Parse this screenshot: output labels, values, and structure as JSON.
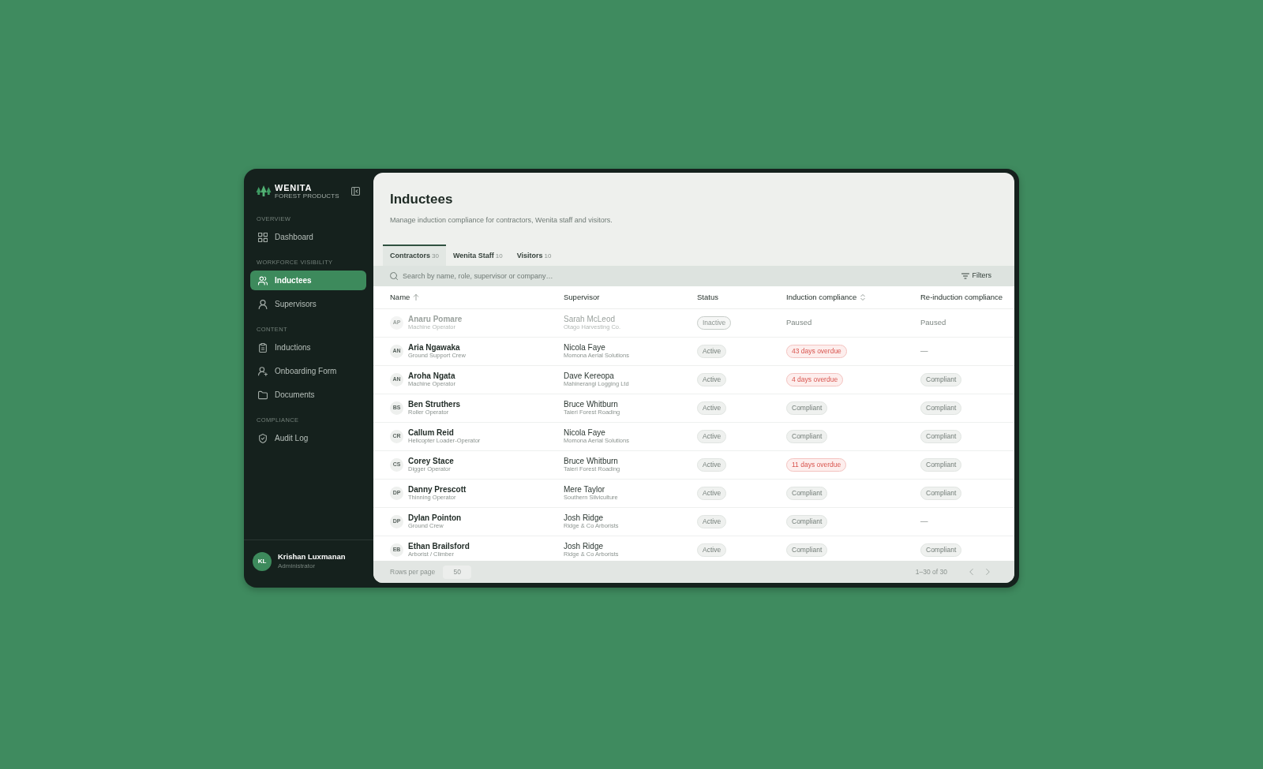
{
  "sidebar": {
    "logo": {
      "name": "WENITA",
      "tagline": "FOREST PRODUCTS"
    },
    "sections": [
      {
        "label": "OVERVIEW",
        "items": [
          {
            "label": "Dashboard",
            "selected": false
          }
        ]
      },
      {
        "label": "WORKFORCE VISIBILITY",
        "items": [
          {
            "label": "Inductees",
            "selected": true
          },
          {
            "label": "Supervisors",
            "selected": false
          }
        ]
      },
      {
        "label": "CONTENT",
        "items": [
          {
            "label": "Inductions",
            "selected": false
          },
          {
            "label": "Onboarding Form",
            "selected": false
          },
          {
            "label": "Documents",
            "selected": false
          }
        ]
      },
      {
        "label": "COMPLIANCE",
        "items": [
          {
            "label": "Audit Log",
            "selected": false
          }
        ]
      }
    ],
    "user": {
      "initials": "KL",
      "name": "Krishan Luxmanan",
      "role": "Administrator"
    }
  },
  "page": {
    "title": "Inductees",
    "subtitle": "Manage induction compliance for contractors, Wenita staff and visitors."
  },
  "tabs": [
    {
      "label": "Contractors",
      "count": "30",
      "selected": true
    },
    {
      "label": "Wenita Staff",
      "count": "10",
      "selected": false
    },
    {
      "label": "Visitors",
      "count": "10",
      "selected": false
    }
  ],
  "search": {
    "placeholder": "Search by name, role, supervisor or company…",
    "filters": "Filters"
  },
  "table": {
    "columns": [
      {
        "label": "Name",
        "sortable": true,
        "sorted": true
      },
      {
        "label": "Supervisor",
        "sortable": false,
        "sorted": false
      },
      {
        "label": "Status",
        "sortable": false,
        "sorted": false
      },
      {
        "label": "Induction compliance",
        "sortable": true,
        "sorted": false
      },
      {
        "label": "Re-induction compliance",
        "sortable": false,
        "sorted": false
      }
    ],
    "rows": [
      {
        "initials": "AP",
        "name": "Anaru Pomare",
        "role": "Machine Operator",
        "supervisor": "Sarah McLeod",
        "company": "Otago Harvesting Co.",
        "dimmed": true,
        "status": {
          "text": "Inactive",
          "kind": "outlined"
        },
        "induction": {
          "text": "Paused",
          "kind": "text"
        },
        "reinduction": {
          "text": "Paused",
          "kind": "text"
        }
      },
      {
        "initials": "AN",
        "name": "Aria Ngawaka",
        "role": "Ground Support Crew",
        "supervisor": "Nicola Faye",
        "company": "Momona Aerial Solutions",
        "dimmed": false,
        "status": {
          "text": "Active",
          "kind": "filled"
        },
        "induction": {
          "text": "43 days overdue",
          "kind": "alert"
        },
        "reinduction": {
          "text": "—",
          "kind": "text"
        }
      },
      {
        "initials": "AN",
        "name": "Aroha Ngata",
        "role": "Machine Operator",
        "supervisor": "Dave Kereopa",
        "company": "Mahinerangi Logging Ltd",
        "dimmed": false,
        "status": {
          "text": "Active",
          "kind": "filled"
        },
        "induction": {
          "text": "4 days overdue",
          "kind": "alert"
        },
        "reinduction": {
          "text": "Compliant",
          "kind": "filled"
        }
      },
      {
        "initials": "BS",
        "name": "Ben Struthers",
        "role": "Roller Operator",
        "supervisor": "Bruce Whitburn",
        "company": "Taieri Forest Roading",
        "dimmed": false,
        "status": {
          "text": "Active",
          "kind": "filled"
        },
        "induction": {
          "text": "Compliant",
          "kind": "filled"
        },
        "reinduction": {
          "text": "Compliant",
          "kind": "filled"
        }
      },
      {
        "initials": "CR",
        "name": "Callum Reid",
        "role": "Helicopter Loader-Operator",
        "supervisor": "Nicola Faye",
        "company": "Momona Aerial Solutions",
        "dimmed": false,
        "status": {
          "text": "Active",
          "kind": "filled"
        },
        "induction": {
          "text": "Compliant",
          "kind": "filled"
        },
        "reinduction": {
          "text": "Compliant",
          "kind": "filled"
        }
      },
      {
        "initials": "CS",
        "name": "Corey Stace",
        "role": "Digger Operator",
        "supervisor": "Bruce Whitburn",
        "company": "Taieri Forest Roading",
        "dimmed": false,
        "status": {
          "text": "Active",
          "kind": "filled"
        },
        "induction": {
          "text": "11 days overdue",
          "kind": "alert"
        },
        "reinduction": {
          "text": "Compliant",
          "kind": "filled"
        }
      },
      {
        "initials": "DP",
        "name": "Danny Prescott",
        "role": "Thinning Operator",
        "supervisor": "Mere Taylor",
        "company": "Southern Silviculture",
        "dimmed": false,
        "status": {
          "text": "Active",
          "kind": "filled"
        },
        "induction": {
          "text": "Compliant",
          "kind": "filled"
        },
        "reinduction": {
          "text": "Compliant",
          "kind": "filled"
        }
      },
      {
        "initials": "DP",
        "name": "Dylan Pointon",
        "role": "Ground Crew",
        "supervisor": "Josh Ridge",
        "company": "Ridge & Co Arborists",
        "dimmed": false,
        "status": {
          "text": "Active",
          "kind": "filled"
        },
        "induction": {
          "text": "Compliant",
          "kind": "filled"
        },
        "reinduction": {
          "text": "—",
          "kind": "text"
        }
      },
      {
        "initials": "EB",
        "name": "Ethan Brailsford",
        "role": "Arborist / Climber",
        "supervisor": "Josh Ridge",
        "company": "Ridge & Co Arborists",
        "dimmed": false,
        "status": {
          "text": "Active",
          "kind": "filled"
        },
        "induction": {
          "text": "Compliant",
          "kind": "filled"
        },
        "reinduction": {
          "text": "Compliant",
          "kind": "filled"
        }
      }
    ]
  },
  "footer": {
    "rows_per_page_label": "Rows per page",
    "rows_per_page": "50",
    "range": "1–30 of 30"
  }
}
